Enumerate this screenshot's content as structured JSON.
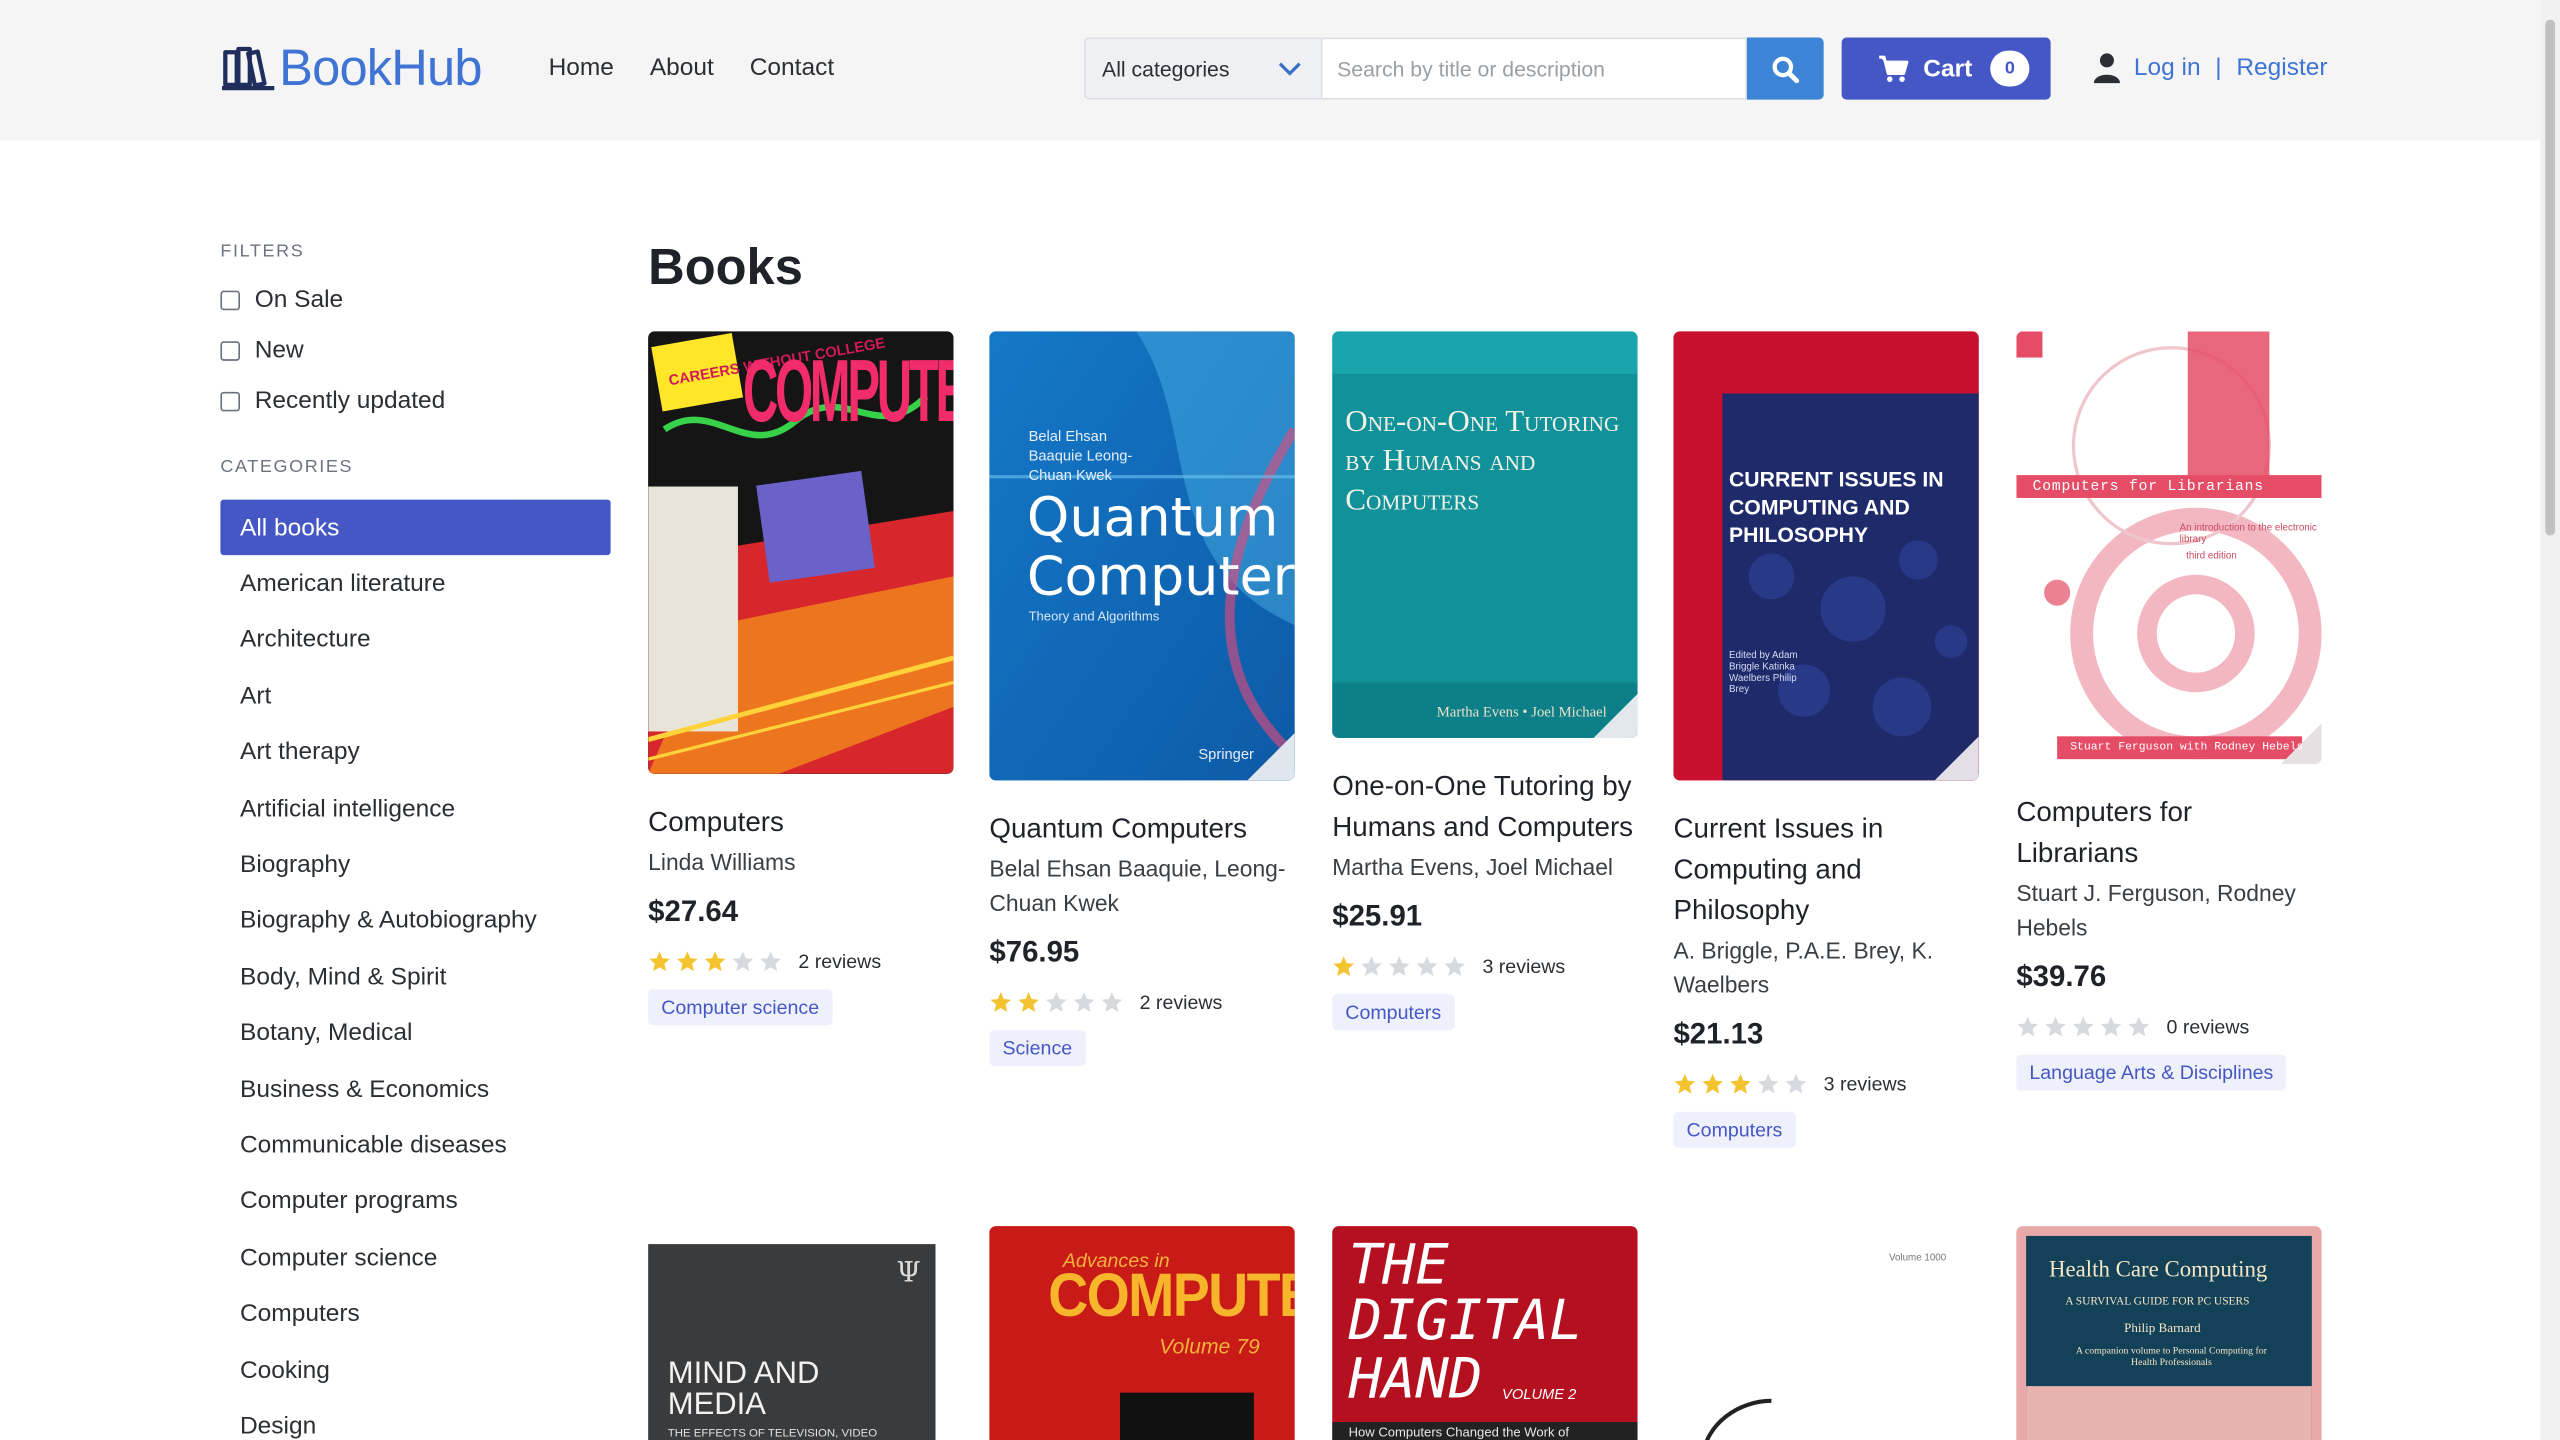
{
  "header": {
    "logo_text": "BookHub",
    "nav": [
      "Home",
      "About",
      "Contact"
    ],
    "category_select": "All categories",
    "search_placeholder": "Search by title or description",
    "cart_label": "Cart",
    "cart_count": "0",
    "login": "Log in",
    "separator": "|",
    "register": "Register"
  },
  "sidebar": {
    "filters_title": "FILTERS",
    "filters": [
      "On Sale",
      "New",
      "Recently updated"
    ],
    "categories_title": "CATEGORIES",
    "categories": [
      "All books",
      "American literature",
      "Architecture",
      "Art",
      "Art therapy",
      "Artificial intelligence",
      "Biography",
      "Biography & Autobiography",
      "Body, Mind & Spirit",
      "Botany, Medical",
      "Business & Economics",
      "Communicable diseases",
      "Computer programs",
      "Computer science",
      "Computers",
      "Cooking",
      "Design"
    ]
  },
  "main": {
    "title": "Books",
    "books": [
      {
        "title": "Computers",
        "author": "Linda Williams",
        "price": "$27.64",
        "rating": 3,
        "reviews": "2 reviews",
        "category": "Computer science"
      },
      {
        "title": "Quantum Computers",
        "author": "Belal Ehsan Baaquie, Leong-Chuan Kwek",
        "price": "$76.95",
        "rating": 2,
        "reviews": "2 reviews",
        "category": "Science"
      },
      {
        "title": "One-on-One Tutoring by Humans and Computers",
        "author": "Martha Evens, Joel Michael",
        "price": "$25.91",
        "rating": 1,
        "reviews": "3 reviews",
        "category": "Computers"
      },
      {
        "title": "Current Issues in Computing and Philosophy",
        "author": "A. Briggle, P.A.E. Brey, K. Waelbers",
        "price": "$21.13",
        "rating": 3,
        "reviews": "3 reviews",
        "category": "Computers"
      },
      {
        "title": "Computers for Librarians",
        "author": "Stuart J. Ferguson, Rodney Hebels",
        "price": "$39.76",
        "rating": 0,
        "reviews": "0 reviews",
        "category": "Language Arts & Disciplines"
      }
    ],
    "covers": {
      "c1": {
        "banner": "COMPUTERS",
        "badge": "CAREERS WITHOUT COLLEGE"
      },
      "c2": {
        "authors": "Belal Ehsan Baaquie Leong-Chuan Kwek",
        "title1": "Quantum",
        "title2": "Computers",
        "sub": "Theory and Algorithms",
        "pub": "Springer"
      },
      "c3": {
        "title": "One-on-One Tutoring by Humans and Computers",
        "authors": "Martha Evens • Joel Michael"
      },
      "c4": {
        "title": "CURRENT ISSUES IN COMPUTING AND PHILOSOPHY",
        "edited": "Edited by Adam Briggle Katinka Waelbers Philip Brey"
      },
      "c5": {
        "title": "Computers for Librarians",
        "sub": "An introduction to the electronic library",
        "ed": "third edition",
        "authors": "Stuart Ferguson with Rodney Hebels"
      },
      "c6": {
        "title": "MIND AND MEDIA",
        "sub": "THE EFFECTS OF TELEVISION, VIDEO"
      },
      "c7": {
        "pre": "Advances in",
        "title": "COMPUTERS",
        "vol": "Volume 79"
      },
      "c8": {
        "title1": "THE",
        "title2": "DIGITAL",
        "title3": "HAND",
        "vol": "VOLUME 2",
        "sub": "How Computers Changed the Work of"
      },
      "c9": {
        "vol": "Volume 1000"
      },
      "c10": {
        "title": "Health Care Computing",
        "sub": "A SURVIVAL GUIDE FOR PC USERS",
        "author": "Philip Barnard",
        "note": "A companion volume to Personal Computing for Health Professionals"
      }
    }
  },
  "colors": {
    "accent": "#4557c4",
    "link": "#3f74d4",
    "star": "#f4c430",
    "star_off": "#d6d9de"
  }
}
